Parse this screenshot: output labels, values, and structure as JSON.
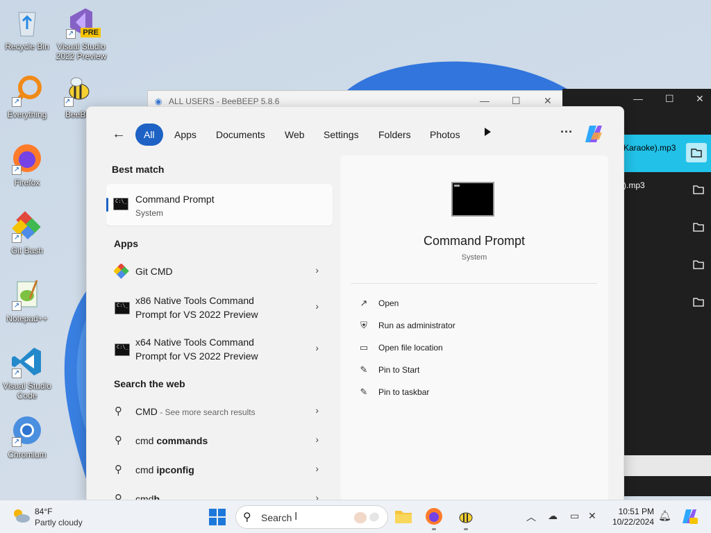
{
  "desktop": {
    "icons": [
      {
        "label": "Recycle Bin"
      },
      {
        "label": "Visual Studio 2022 Preview",
        "badge": "PRE"
      },
      {
        "label": "Everything"
      },
      {
        "label": "BeeBEEP"
      },
      {
        "label": "Firefox"
      },
      {
        "label": "Git Bash"
      },
      {
        "label": "Notepad++"
      },
      {
        "label": "Visual Studio Code"
      },
      {
        "label": "Chromium"
      }
    ]
  },
  "bg_windows": {
    "beebeep_title": "ALL USERS - BeeBEEP 5.8.6",
    "file_rows": [
      "Karaoke).mp3",
      ").mp3"
    ]
  },
  "search_panel": {
    "tabs": [
      "All",
      "Apps",
      "Documents",
      "Web",
      "Settings",
      "Folders",
      "Photos"
    ],
    "active_tab": "All",
    "best_match_heading": "Best match",
    "best_match": {
      "title": "Command Prompt",
      "subtitle": "System"
    },
    "apps_heading": "Apps",
    "apps": [
      {
        "line1": "Git CMD",
        "line2": ""
      },
      {
        "line1": "x86 Native Tools Command",
        "line2": "Prompt for VS 2022 Preview"
      },
      {
        "line1": "x64 Native Tools Command",
        "line2": "Prompt for VS 2022 Preview"
      }
    ],
    "web_heading": "Search the web",
    "web_results": [
      {
        "prefix": "CMD",
        "bold": "",
        "hint": " - See more search results"
      },
      {
        "prefix": "cmd ",
        "bold": "commands",
        "hint": ""
      },
      {
        "prefix": "cmd ",
        "bold": "ipconfig",
        "hint": ""
      },
      {
        "prefix": "cmd",
        "bold": "b",
        "hint": ""
      }
    ],
    "preview": {
      "title": "Command Prompt",
      "subtitle": "System",
      "actions": [
        "Open",
        "Run as administrator",
        "Open file location",
        "Pin to Start",
        "Pin to taskbar"
      ]
    }
  },
  "taskbar": {
    "weather_temp": "84°F",
    "weather_desc": "Partly cloudy",
    "search_placeholder": "Search",
    "time": "10:51 PM",
    "date": "10/22/2024"
  },
  "icons": {
    "back": "arrow-left-icon",
    "more": "more-horizontal-icon",
    "search": "search-icon",
    "chevron": "chevron-right-icon"
  },
  "colors": {
    "accent": "#1d62c4",
    "selection_cyan": "#22c1e8",
    "windows_blue": "#1e78d9"
  }
}
